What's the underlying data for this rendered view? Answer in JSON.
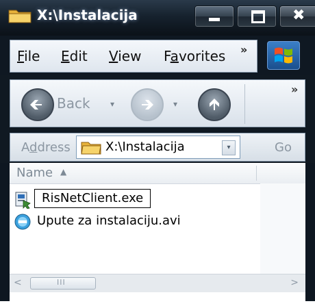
{
  "window": {
    "title": "X:\\Instalacija"
  },
  "menu": {
    "file": {
      "underline": "F",
      "rest": "ile"
    },
    "edit": {
      "underline": "E",
      "rest": "dit"
    },
    "view": {
      "underline": "V",
      "rest": "iew"
    },
    "favorites": {
      "pre": "F",
      "underline": "a",
      "rest": "vorites"
    },
    "overflow": "»"
  },
  "nav": {
    "back_label": "Back",
    "dropdown_glyph": "▾",
    "overflow": "»"
  },
  "address": {
    "label_pre": "A",
    "label_underline": "d",
    "label_rest": "dress",
    "value": "X:\\Instalacija",
    "go_label": "Go"
  },
  "list": {
    "column_name": "Name",
    "sort_glyph": "▲",
    "files": [
      {
        "name": "RisNetClient.exe",
        "icon": "installer-icon",
        "editing": true
      },
      {
        "name": "Upute za instalaciju.avi",
        "icon": "video-file-icon",
        "editing": false
      }
    ]
  },
  "scrollbar": {
    "left_arrow": "<",
    "right_arrow": ">",
    "grip": "III"
  }
}
